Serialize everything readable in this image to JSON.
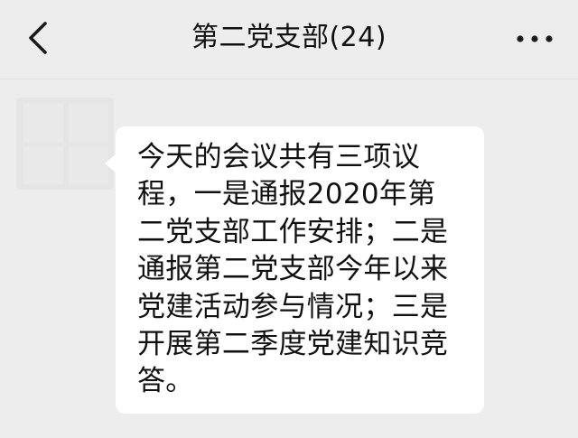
{
  "header": {
    "title": "第二党支部(24)",
    "back_icon": "chevron-left-icon",
    "more_icon": "more-dots-icon"
  },
  "message": {
    "lines": [
      "今天的会议共有三项议",
      "程，一是通报2020年第",
      "二党支部工作安排；二是",
      "通报第二党支部今年以来",
      "党建活动参与情况；三是",
      "开展第二季度党建知识竞",
      "答。"
    ]
  },
  "colors": {
    "background": "#ededed",
    "bubble": "#ffffff",
    "text": "#111111"
  }
}
